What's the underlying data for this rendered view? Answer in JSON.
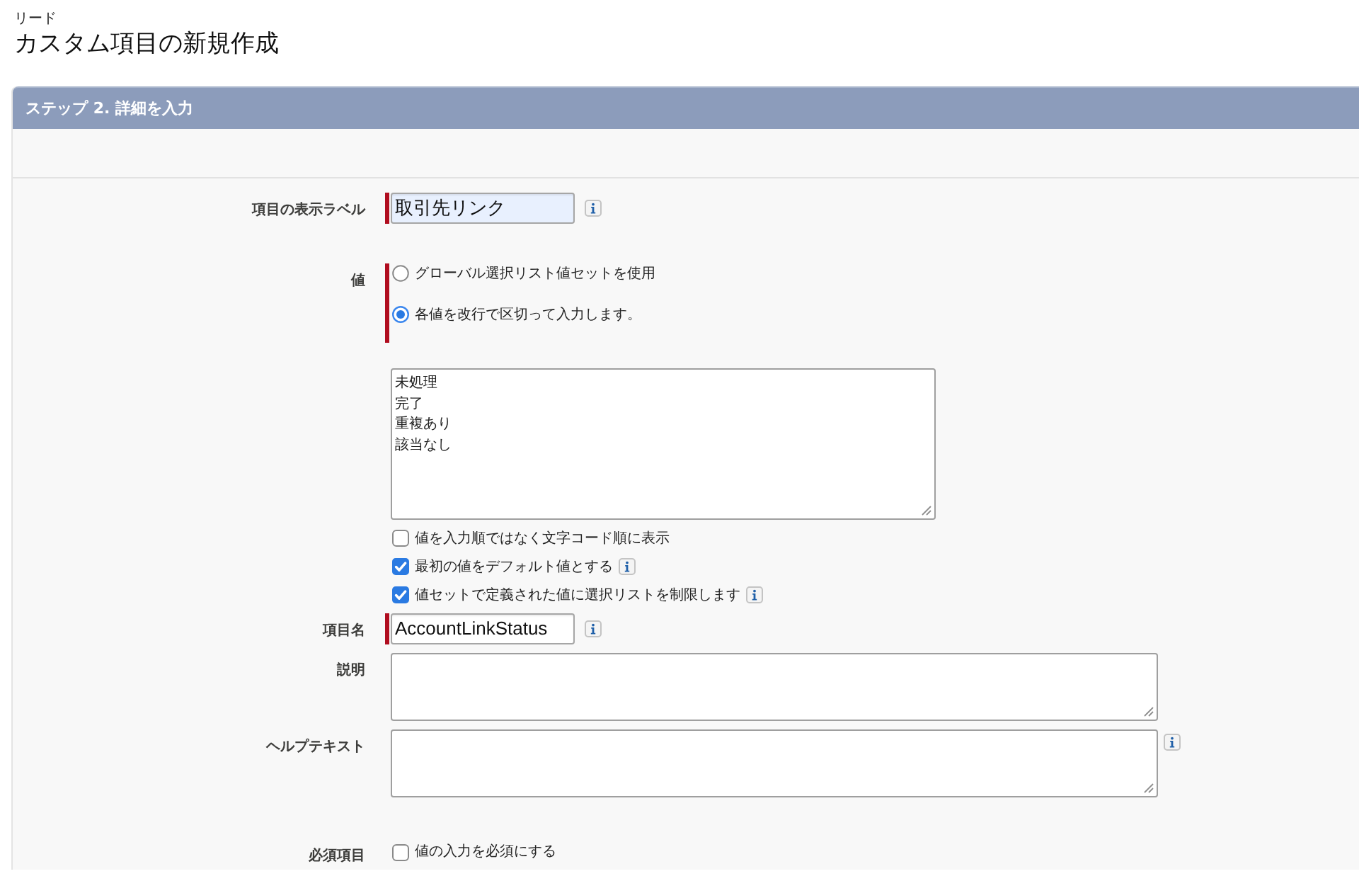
{
  "breadcrumb": "リード",
  "title": "カスタム項目の新規作成",
  "step": {
    "title": "ステップ 2. 詳細を入力"
  },
  "fields": [
    {
      "kind": "text",
      "label": "項目の表示ラベル",
      "required": true,
      "value": "取引先リンク",
      "autofilled": true,
      "info": true
    },
    {
      "kind": "radio-group",
      "label": "値",
      "required": true,
      "options": [
        {
          "label": "グローバル選択リスト値セットを使用",
          "selected": false
        },
        {
          "label": "各値を改行で区切って入力します。",
          "selected": true
        }
      ]
    },
    {
      "kind": "values",
      "lines": [
        "未処理",
        "完了",
        "重複あり",
        "該当なし"
      ]
    },
    {
      "kind": "checkbox",
      "text": "値を入力順ではなく文字コード順に表示",
      "checked": false,
      "info": false
    },
    {
      "kind": "checkbox",
      "text": "最初の値をデフォルト値とする",
      "checked": true,
      "info": true
    },
    {
      "kind": "checkbox",
      "text": "値セットで定義された値に選択リストを制限します",
      "checked": true,
      "info": true
    },
    {
      "kind": "text",
      "label": "項目名",
      "required": true,
      "value": "AccountLinkStatus",
      "autofilled": false,
      "info": true
    },
    {
      "kind": "textarea",
      "label": "説明",
      "required": false,
      "info": false
    },
    {
      "kind": "textarea",
      "label": "ヘルプテキスト",
      "required": false,
      "info": true
    },
    {
      "kind": "checkbox",
      "label": "必須項目",
      "text": "値の入力を必須にする",
      "checked": false,
      "info": false
    }
  ]
}
